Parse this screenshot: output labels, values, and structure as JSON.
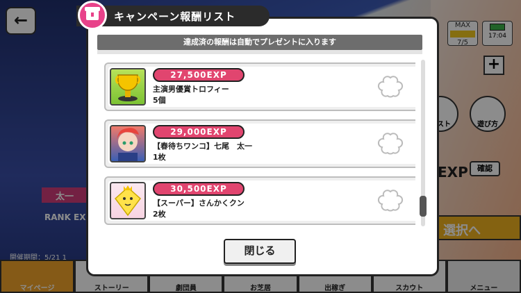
{
  "background": {
    "back_glyph": "←",
    "max_label": "MAX",
    "stamina": "7/5",
    "clock": "17:04",
    "plus_glyph": "+",
    "list_label": "リスト",
    "howto_label": "遊び方",
    "exp_label": "EXP",
    "confirm_label": "確認",
    "select_label": "選択へ",
    "name_label": "太一",
    "rank_label": "RANK EX",
    "period_label": "開催期間：5/21 1",
    "tabs": [
      "マイページ",
      "ストーリー",
      "劇団員",
      "お芝居",
      "出稼ぎ",
      "スカウト",
      "メニュー"
    ]
  },
  "modal": {
    "title": "キャンペーン報酬リスト",
    "notice": "達成済の報酬は自動でプレゼントに入ります",
    "close_label": "閉じる",
    "accent": "#e1456f",
    "items": [
      {
        "exp": "27,500EXP",
        "name": "主演男優賞トロフィー",
        "qty": "5個",
        "icon": "trophy-icon"
      },
      {
        "exp": "29,000EXP",
        "name": "【春待ちワンコ】七尾　太一",
        "qty": "1枚",
        "icon": "character-card-icon"
      },
      {
        "exp": "30,500EXP",
        "name": "【スーパー】さんかくクン",
        "qty": "2枚",
        "icon": "sankaku-kun-icon"
      }
    ]
  }
}
